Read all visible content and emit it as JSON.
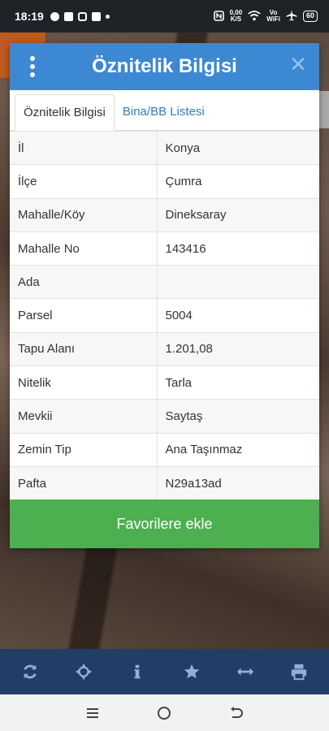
{
  "status_bar": {
    "time": "18:19",
    "net_speed_top": "0,00",
    "net_speed_unit": "K/S",
    "wifi_label_top": "Vo",
    "wifi_label_bottom": "WiFi",
    "battery": "60"
  },
  "modal": {
    "title": "Öznitelik Bilgisi",
    "close_glyph": "✕",
    "tabs": [
      {
        "label": "Öznitelik Bilgisi",
        "active": true
      },
      {
        "label": "Bina/BB Listesi",
        "active": false
      }
    ],
    "rows": [
      {
        "key": "İl",
        "value": "Konya"
      },
      {
        "key": "İlçe",
        "value": "Çumra"
      },
      {
        "key": "Mahalle/Köy",
        "value": "Dineksaray"
      },
      {
        "key": "Mahalle No",
        "value": "143416"
      },
      {
        "key": "Ada",
        "value": ""
      },
      {
        "key": "Parsel",
        "value": "5004"
      },
      {
        "key": "Tapu Alanı",
        "value": "1.201,08"
      },
      {
        "key": "Nitelik",
        "value": "Tarla"
      },
      {
        "key": "Mevkii",
        "value": "Saytaş"
      },
      {
        "key": "Zemin Tip",
        "value": "Ana Taşınmaz"
      },
      {
        "key": "Pafta",
        "value": "N29a13ad"
      }
    ],
    "favorite_button": "Favorilere ekle"
  },
  "toolbar": {
    "icons": [
      "refresh-icon",
      "locate-icon",
      "info-icon",
      "star-icon",
      "measure-icon",
      "print-icon"
    ]
  },
  "navbar": {
    "icons": [
      "menu-icon",
      "home-icon",
      "back-icon"
    ]
  },
  "colors": {
    "header_blue": "#3d88d3",
    "tab_link_blue": "#2f7fc1",
    "button_green": "#4caf50",
    "toolbar_navy": "#223e66",
    "toolbar_icon": "#8fb1d9"
  }
}
